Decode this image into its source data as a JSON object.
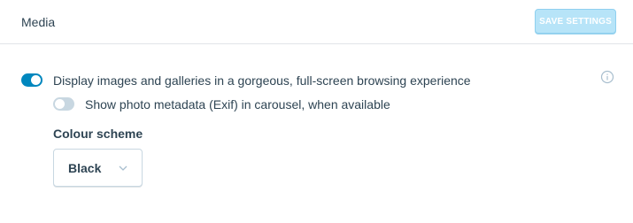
{
  "header": {
    "title": "Media",
    "save_label": "SAVE SETTINGS"
  },
  "settings": {
    "carousel": {
      "enabled": true,
      "label": "Display images and galleries in a gorgeous, full-screen browsing experience"
    },
    "exif": {
      "enabled": false,
      "label": "Show photo metadata (Exif) in carousel, when available"
    },
    "colour_scheme": {
      "label": "Colour scheme",
      "selected": "Black"
    }
  },
  "icons": {
    "info": "info-icon",
    "chevron": "chevron-down-icon"
  },
  "colors": {
    "accent": "#0087be",
    "button_disabled": "#b7e4f8",
    "toggle_off": "#c8d7e1",
    "text": "#2e4453"
  }
}
